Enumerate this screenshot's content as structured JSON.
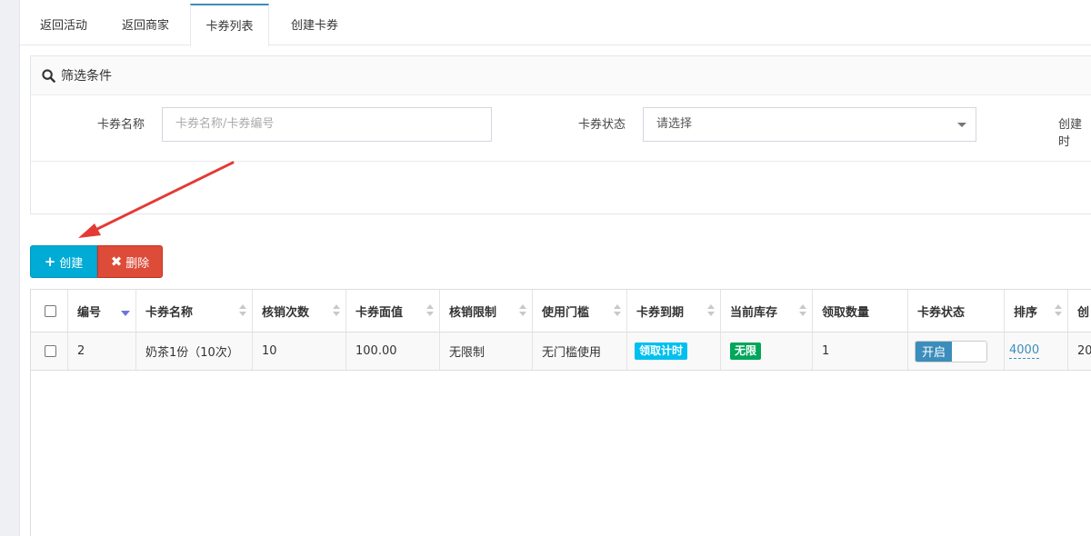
{
  "tabs": [
    {
      "label": "返回活动",
      "active": false
    },
    {
      "label": "返回商家",
      "active": false
    },
    {
      "label": "卡券列表",
      "active": true
    },
    {
      "label": "创建卡券",
      "active": false
    }
  ],
  "filter": {
    "title": "筛选条件",
    "name_label": "卡券名称",
    "name_placeholder": "卡券名称/卡券编号",
    "status_label": "卡券状态",
    "status_value": "请选择",
    "created_label": "创建时"
  },
  "toolbar": {
    "create_label": "创建",
    "delete_label": "删除"
  },
  "table": {
    "headers": [
      "编号",
      "卡券名称",
      "核销次数",
      "卡券面值",
      "核销限制",
      "使用门槛",
      "卡券到期",
      "当前库存",
      "领取数量",
      "卡券状态",
      "排序",
      "创"
    ],
    "rows": [
      {
        "id": "2",
        "name": "奶茶1份（10次）",
        "redeem_count": "10",
        "face_value": "100.00",
        "redeem_limit": "无限制",
        "threshold": "无门槛使用",
        "expiry": "领取计时",
        "stock": "无限",
        "received": "1",
        "status": "开启",
        "sort": "4000",
        "created": "20"
      }
    ]
  },
  "colors": {
    "primary": "#3c8dbc",
    "create_btn": "#00acd6",
    "delete_btn": "#dd4b39",
    "expiry_badge": "#00c0ef",
    "stock_badge": "#00a65a",
    "annotation_arrow": "#e53935"
  }
}
